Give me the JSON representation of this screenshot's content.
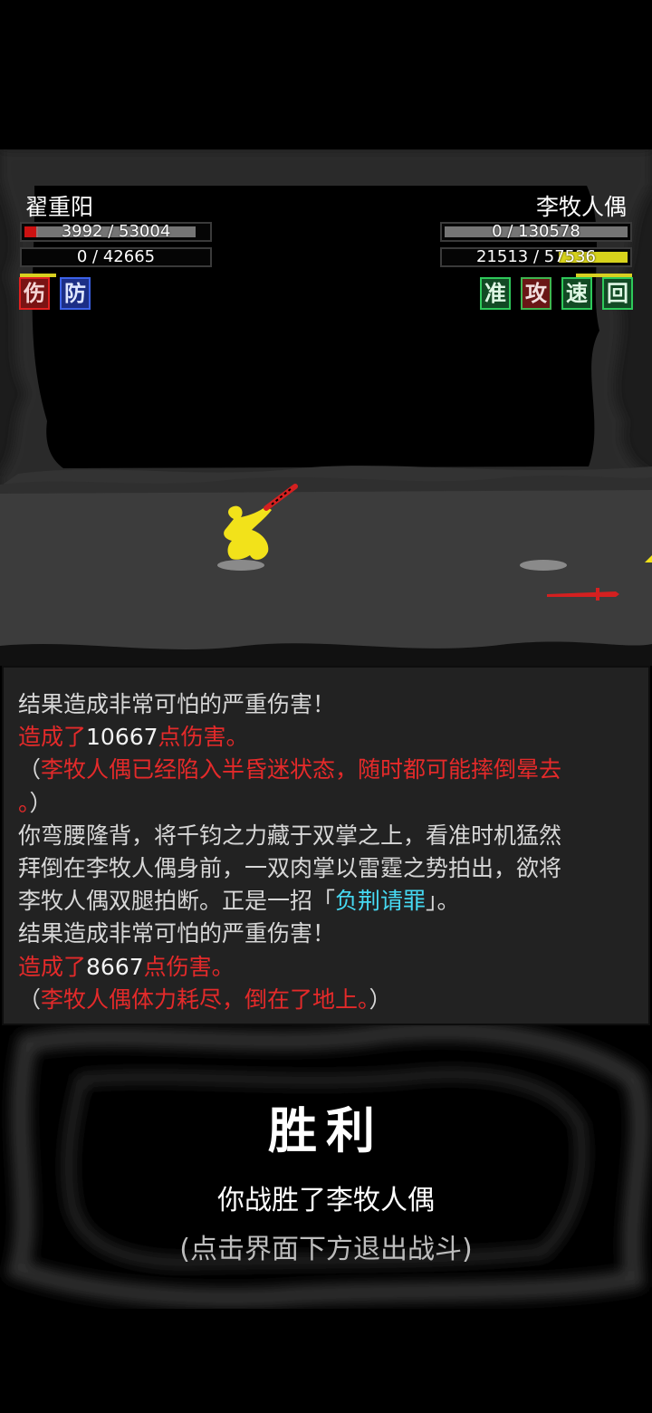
{
  "player": {
    "name": "翟重阳",
    "hp_text": "3992 / 53004",
    "hp_fraction": 0.075,
    "mp_text": "0 / 42665",
    "mp_fraction": 0,
    "status_tags": [
      {
        "char": "伤",
        "style": "red"
      },
      {
        "char": "防",
        "style": "blue"
      }
    ]
  },
  "enemy": {
    "name": "李牧人偶",
    "hp_text": "0 / 130578",
    "hp_fraction": 0,
    "mp_text": "21513 / 57536",
    "mp_fraction": 0.374,
    "status_tags": [
      {
        "char": "准",
        "style": "green"
      },
      {
        "char": "攻",
        "style": "darkred"
      },
      {
        "char": "速",
        "style": "green"
      },
      {
        "char": "回",
        "style": "green"
      }
    ]
  },
  "log": {
    "lines": [
      [
        {
          "t": "结果造成非常可怕的严重伤害！",
          "c": "normal"
        }
      ],
      [
        {
          "t": "造成了",
          "c": "red"
        },
        {
          "t": "10667",
          "c": "white"
        },
        {
          "t": "点伤害。",
          "c": "red"
        }
      ],
      [
        {
          "t": "（",
          "c": "normal"
        },
        {
          "t": "李牧人偶已经陷入半昏迷状态，随时都可能摔倒晕去",
          "c": "red"
        }
      ],
      [
        {
          "t": "。",
          "c": "red"
        },
        {
          "t": "）",
          "c": "normal"
        }
      ],
      [
        {
          "t": "你弯腰隆背，将千钧之力藏于双掌之上，看准时机猛然",
          "c": "normal"
        }
      ],
      [
        {
          "t": "拜倒在李牧人偶身前，一双肉掌以雷霆之势拍出，欲将",
          "c": "normal"
        }
      ],
      [
        {
          "t": "李牧人偶双腿拍断。正是一招「",
          "c": "normal"
        },
        {
          "t": "负荆请罪",
          "c": "cyan"
        },
        {
          "t": "」。",
          "c": "normal"
        }
      ],
      [
        {
          "t": "结果造成非常可怕的严重伤害！",
          "c": "normal"
        }
      ],
      [
        {
          "t": "造成了",
          "c": "red"
        },
        {
          "t": "8667",
          "c": "white"
        },
        {
          "t": "点伤害。",
          "c": "red"
        }
      ],
      [
        {
          "t": "（",
          "c": "normal"
        },
        {
          "t": "李牧人偶体力耗尽，倒在了地上。",
          "c": "red"
        },
        {
          "t": "）",
          "c": "normal"
        }
      ]
    ]
  },
  "result": {
    "title": "胜利",
    "subtitle": "你战胜了李牧人偶",
    "hint": "(点击界面下方退出战斗)"
  },
  "colors": {
    "hp": "#cc1111",
    "bar_grey": "#8a8a8a",
    "mp_enemy": "#d7d21c",
    "fighter": "#f2e21a",
    "blade": "#d42020"
  }
}
